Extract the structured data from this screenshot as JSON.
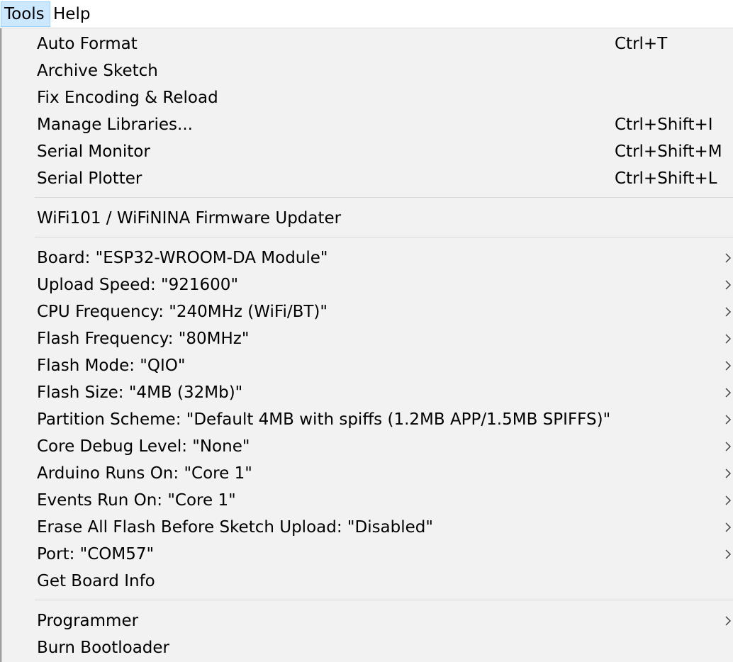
{
  "menubar": {
    "tools_label": "Tools",
    "help_label": "Help"
  },
  "menu": {
    "group1": [
      {
        "label": "Auto Format",
        "shortcut": "Ctrl+T"
      },
      {
        "label": "Archive Sketch",
        "shortcut": ""
      },
      {
        "label": "Fix Encoding & Reload",
        "shortcut": ""
      },
      {
        "label": "Manage Libraries...",
        "shortcut": "Ctrl+Shift+I"
      },
      {
        "label": "Serial Monitor",
        "shortcut": "Ctrl+Shift+M"
      },
      {
        "label": "Serial Plotter",
        "shortcut": "Ctrl+Shift+L"
      }
    ],
    "group2": [
      {
        "label": "WiFi101 / WiFiNINA Firmware Updater"
      }
    ],
    "group3": [
      {
        "label": "Board: \"ESP32-WROOM-DA Module\""
      },
      {
        "label": "Upload Speed: \"921600\""
      },
      {
        "label": "CPU Frequency: \"240MHz (WiFi/BT)\""
      },
      {
        "label": "Flash Frequency: \"80MHz\""
      },
      {
        "label": "Flash Mode: \"QIO\""
      },
      {
        "label": "Flash Size: \"4MB (32Mb)\""
      },
      {
        "label": "Partition Scheme: \"Default 4MB with spiffs (1.2MB APP/1.5MB SPIFFS)\""
      },
      {
        "label": "Core Debug Level: \"None\""
      },
      {
        "label": "Arduino Runs On: \"Core 1\""
      },
      {
        "label": "Events Run On: \"Core 1\""
      },
      {
        "label": "Erase All Flash Before Sketch Upload: \"Disabled\""
      },
      {
        "label": "Port: \"COM57\""
      },
      {
        "label": "Get Board Info"
      }
    ],
    "group4": [
      {
        "label": "Programmer"
      },
      {
        "label": "Burn Bootloader"
      }
    ]
  },
  "icons": {
    "chevron": "chevron-right-icon"
  }
}
